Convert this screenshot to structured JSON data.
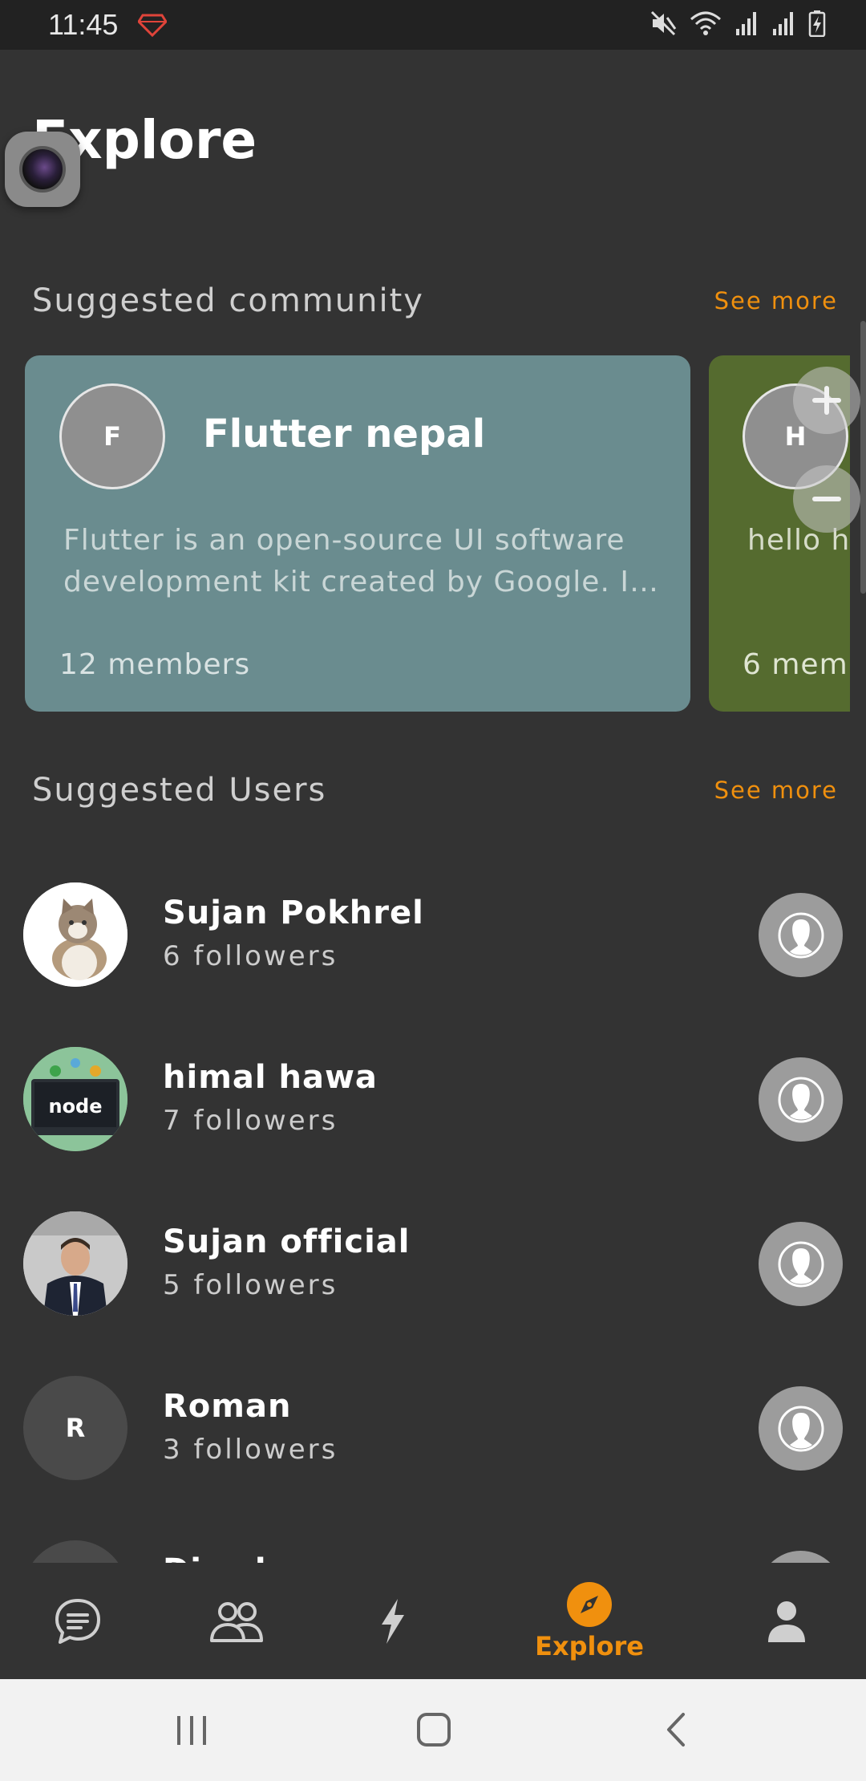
{
  "status_bar": {
    "time": "11:45",
    "icons": [
      "ruby-icon",
      "mute-icon",
      "wifi-icon",
      "signal-icon",
      "signal-icon",
      "battery-charging-icon"
    ]
  },
  "page": {
    "title": "Explore"
  },
  "communities_section": {
    "title": "Suggested community",
    "see_more": "See more",
    "cards": [
      {
        "initial": "F",
        "name": "Flutter nepal",
        "description": "Flutter is an open-source UI software development kit created by Google. I…",
        "members": "12 members",
        "color": "#6a8c8f"
      },
      {
        "initial": "H",
        "name": "",
        "description": "hello h",
        "members": "6 mem",
        "color": "#556b2f"
      }
    ]
  },
  "users_section": {
    "title": "Suggested Users",
    "see_more": "See more",
    "users": [
      {
        "name": "Sujan Pokhrel",
        "followers": "6 followers",
        "avatar": "cat-photo"
      },
      {
        "name": "himal hawa",
        "followers": "7 followers",
        "avatar": "node-laptop-photo"
      },
      {
        "name": "Sujan official",
        "followers": "5 followers",
        "avatar": "man-in-suit-photo"
      },
      {
        "name": "Roman",
        "followers": "3 followers",
        "avatar": "initial",
        "initial": "R"
      },
      {
        "name": "Diwakar",
        "followers": "",
        "avatar": "initial",
        "initial": ""
      }
    ]
  },
  "bottom_nav": {
    "items": [
      {
        "icon": "chat-icon",
        "label": ""
      },
      {
        "icon": "people-icon",
        "label": ""
      },
      {
        "icon": "lightning-icon",
        "label": ""
      },
      {
        "icon": "compass-icon",
        "label": "Explore",
        "active": true
      },
      {
        "icon": "person-icon",
        "label": ""
      }
    ]
  },
  "colors": {
    "background": "#333333",
    "accent": "#f0900e",
    "card_1": "#6a8c8f",
    "card_2": "#556b2f"
  }
}
